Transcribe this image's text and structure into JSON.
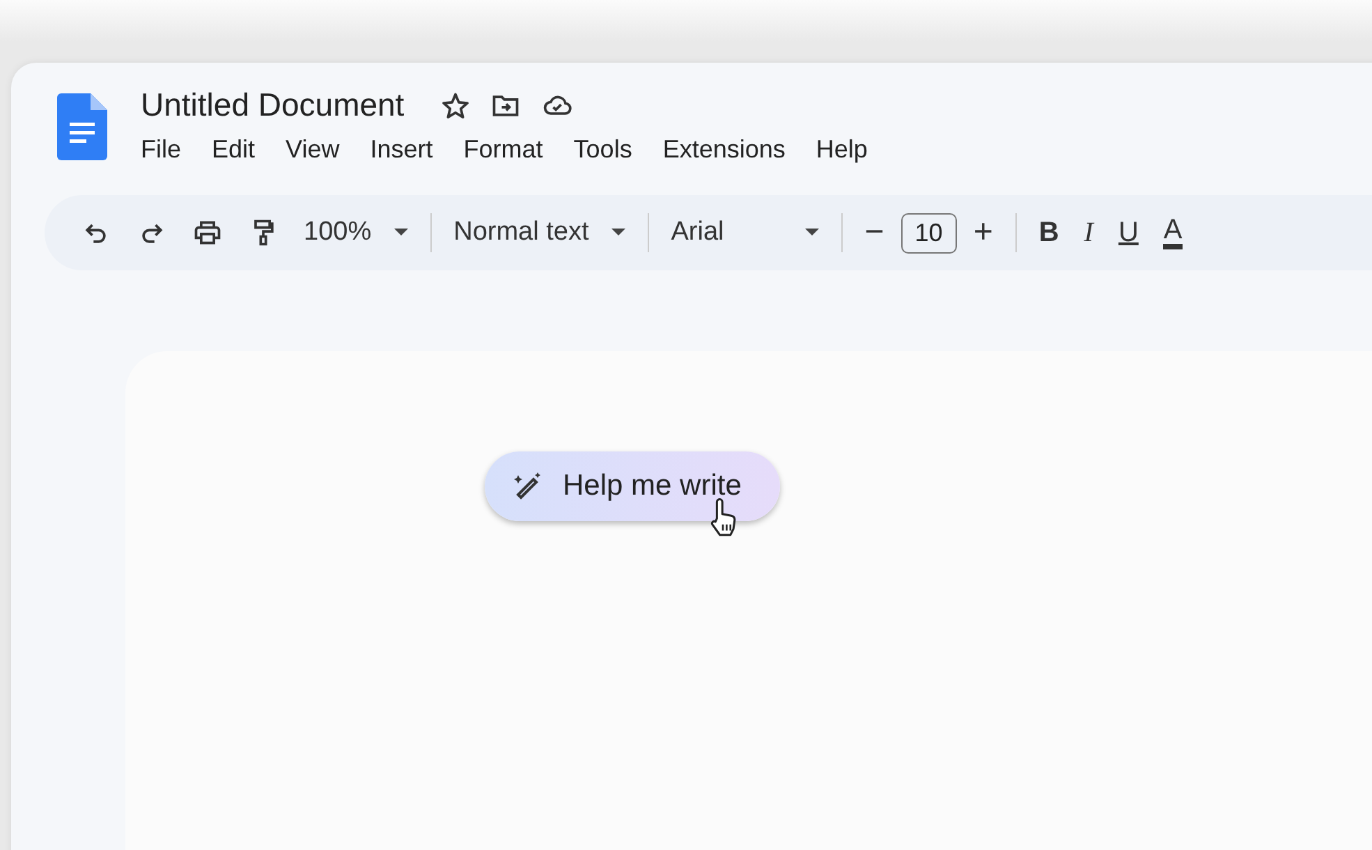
{
  "document": {
    "title": "Untitled Document"
  },
  "menu": [
    "File",
    "Edit",
    "View",
    "Insert",
    "Format",
    "Tools",
    "Extensions",
    "Help"
  ],
  "toolbar": {
    "zoom": "100%",
    "style": "Normal text",
    "font": "Arial",
    "font_size": "10",
    "decrease": "−",
    "increase": "+",
    "format_buttons": [
      {
        "kind": "bold",
        "label": "B"
      },
      {
        "kind": "italic",
        "label": "I"
      },
      {
        "kind": "underline",
        "label": "U"
      },
      {
        "kind": "color",
        "label": "A"
      }
    ]
  },
  "help_button": {
    "label": "Help me write"
  }
}
